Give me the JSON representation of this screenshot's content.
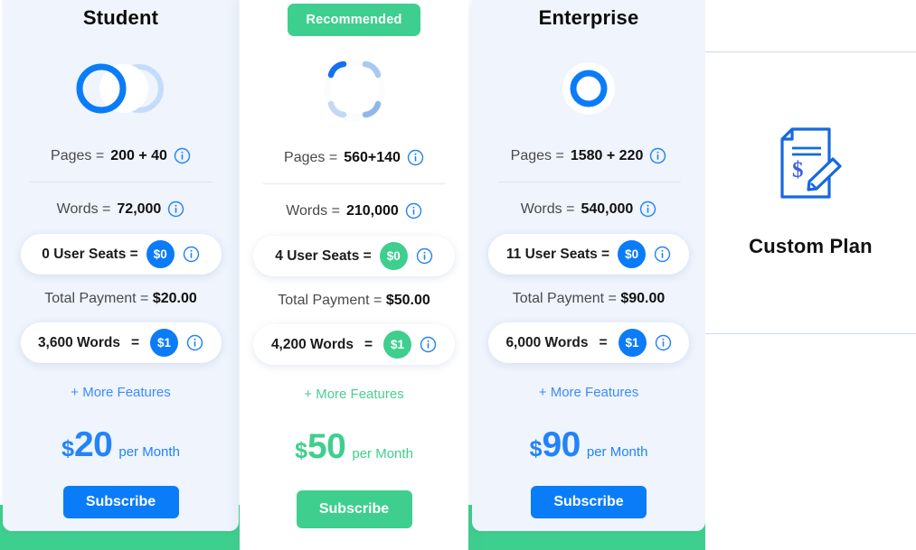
{
  "colors": {
    "blue": "#0b7cf8",
    "blue_text": "#2383f8",
    "green": "#3ecf8e",
    "card_bg": "#eff4fd",
    "white": "#ffffff",
    "link_blue": "#3d8bfd",
    "muted_text": "#4a4a4a"
  },
  "plans": [
    {
      "id": "student",
      "title": "Student",
      "icon": "two-overlapping-rings-icon",
      "pages_label": "Pages =",
      "pages_value": "200 + 40",
      "words_label": "Words =",
      "words_value": "72,000",
      "seats_label": "0 User Seats =",
      "seats_chip": "$0",
      "total_label": "Total Payment =",
      "total_value": "$20.00",
      "extra_words_label": "3,600 Words",
      "extra_words_eq": "=",
      "extra_words_chip": "$1",
      "more_features": "+ More Features",
      "price_currency": "$",
      "price_amount": "20",
      "price_period": "per Month",
      "subscribe": "Subscribe"
    },
    {
      "id": "pro",
      "title": "",
      "badge": "Recommended",
      "icon": "loading-spinner-square-icon",
      "pages_label": "Pages =",
      "pages_value": "560+140",
      "words_label": "Words =",
      "words_value": "210,000",
      "seats_label": "4 User Seats =",
      "seats_chip": "$0",
      "total_label": "Total Payment =",
      "total_value": "$50.00",
      "extra_words_label": "4,200 Words",
      "extra_words_eq": "=",
      "extra_words_chip": "$1",
      "more_features": "+ More Features",
      "price_currency": "$",
      "price_amount": "50",
      "price_period": "per Month",
      "subscribe": "Subscribe"
    },
    {
      "id": "enterprise",
      "title": "Enterprise",
      "icon": "single-ring-icon",
      "pages_label": "Pages =",
      "pages_value": "1580 + 220",
      "words_label": "Words =",
      "words_value": "540,000",
      "seats_label": "11 User Seats =",
      "seats_chip": "$0",
      "total_label": "Total Payment =",
      "total_value": "$90.00",
      "extra_words_label": "6,000 Words",
      "extra_words_eq": "=",
      "extra_words_chip": "$1",
      "more_features": "+ More Features",
      "price_currency": "$",
      "price_amount": "90",
      "price_period": "per Month",
      "subscribe": "Subscribe"
    }
  ],
  "custom_plan": {
    "icon": "document-dollar-pencil-icon",
    "title": "Custom Plan"
  },
  "icons": {
    "info": "info-circle-icon"
  }
}
